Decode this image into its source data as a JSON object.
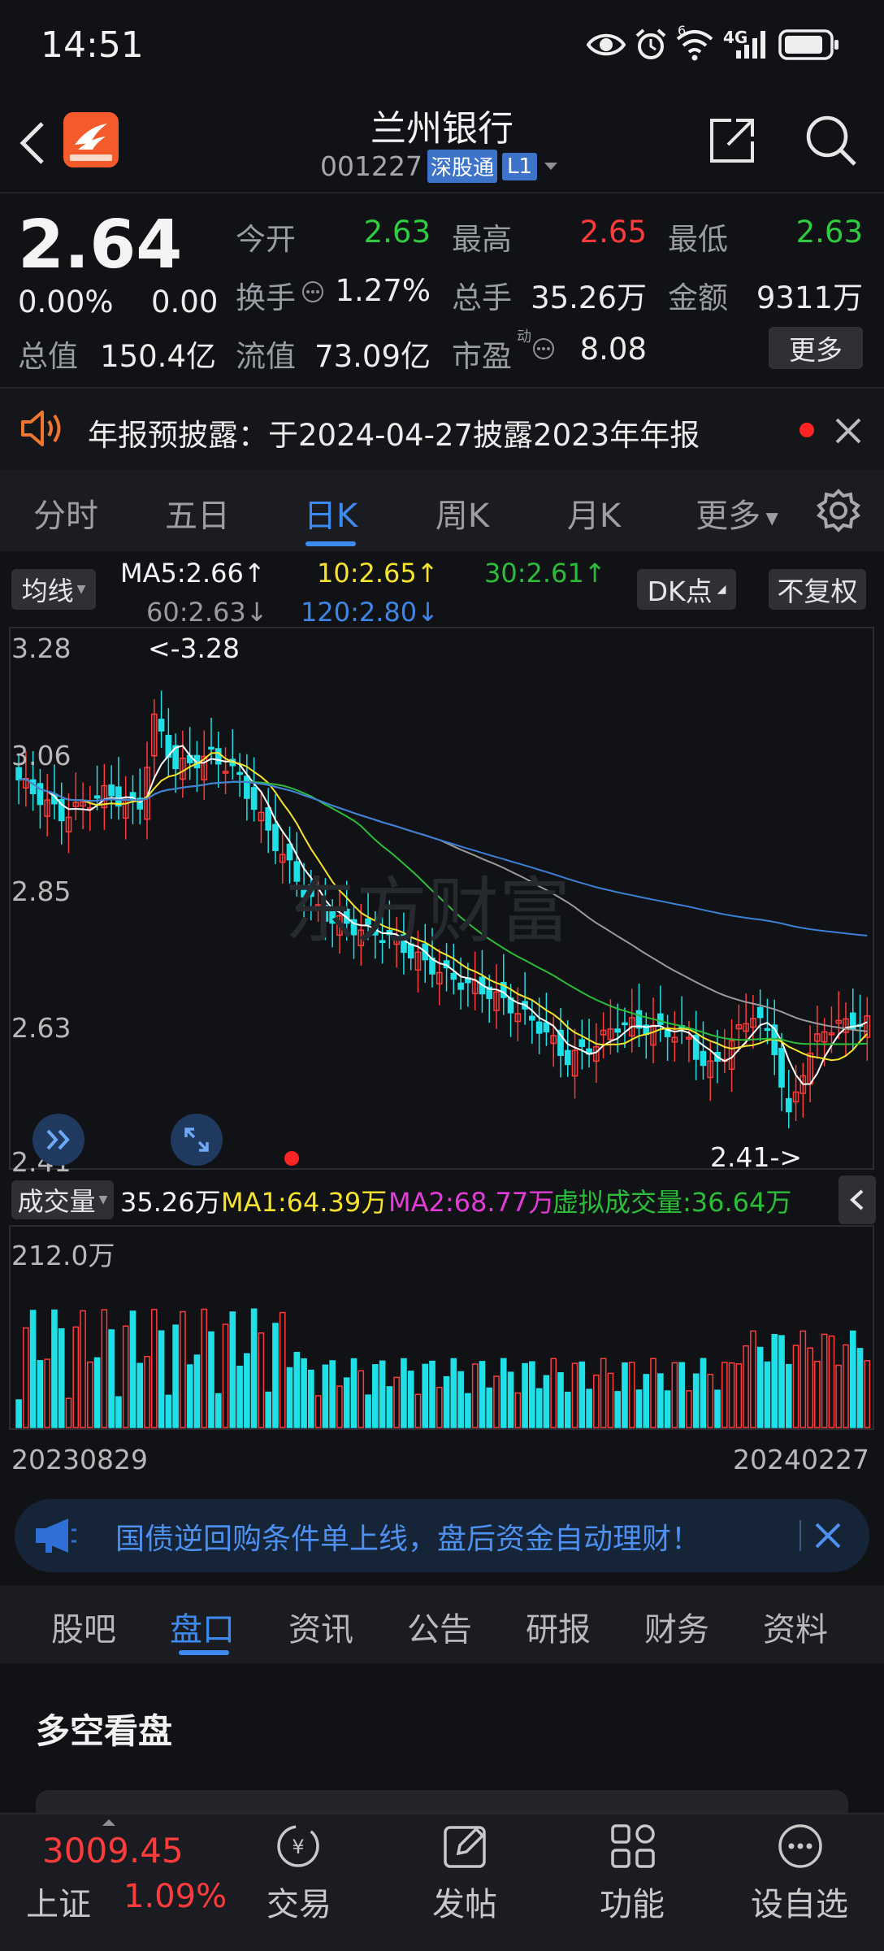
{
  "status_bar": {
    "time": "14:51",
    "signal": "4G",
    "wifi_badge": "6"
  },
  "header": {
    "title": "兰州银行",
    "code": "001227",
    "market_badge": "深股通",
    "level_badge": "L1"
  },
  "quote": {
    "price": "2.64",
    "change_pct": "0.00%",
    "change_amt": "0.00",
    "open_label": "今开",
    "open": "2.63",
    "high_label": "最高",
    "high": "2.65",
    "low_label": "最低",
    "low": "2.63",
    "turnover_label": "换手",
    "turnover": "1.27%",
    "volume_label": "总手",
    "volume": "35.26万",
    "amount_label": "金额",
    "amount": "9311万",
    "mktcap_label": "总值",
    "mktcap": "150.4亿",
    "float_label": "流值",
    "float": "73.09亿",
    "pe_label": "市盈",
    "pe_sup": "动",
    "pe": "8.08",
    "more_label": "更多"
  },
  "notice": {
    "text": "年报预披露：于2024-04-27披露2023年年报"
  },
  "chart_tabs": [
    "分时",
    "五日",
    "日K",
    "周K",
    "月K",
    "更多"
  ],
  "ma": {
    "selector": "均线",
    "ma5": "MA5:2.66↑",
    "ma10": "10:2.65↑",
    "ma30": "30:2.61↑",
    "ma60": "60:2.63↓",
    "ma120": "120:2.80↓",
    "dk": "DK点",
    "fq": "不复权"
  },
  "kline": {
    "ticks": [
      "3.28",
      "3.06",
      "2.85",
      "2.63",
      "2.41"
    ],
    "max_label": "<-3.28",
    "min_label": "2.41->",
    "watermark": "东方财富"
  },
  "volume_panel": {
    "selector": "成交量",
    "current": "35.26万",
    "ma1": "MA1:64.39万",
    "ma2": "MA2:68.77万",
    "virtual": "虚拟成交量:36.64万",
    "max_label": "212.0万",
    "date_start": "20230829",
    "date_end": "20240227"
  },
  "chart_data": {
    "type": "candlestick",
    "x_start": "20230829",
    "x_end": "20240227",
    "ylim": [
      2.41,
      3.28
    ],
    "y_ticks": [
      3.28,
      3.06,
      2.85,
      2.63,
      2.41
    ],
    "ma": {
      "MA5": 2.66,
      "MA10": 2.65,
      "MA30": 2.61,
      "MA60": 2.63,
      "MA120": 2.8
    },
    "max": 3.28,
    "min": 2.41,
    "last_close": 2.64,
    "volume": {
      "max": "212.0万",
      "current": "35.26万",
      "MA1": "64.39万",
      "MA2": "68.77万",
      "virtual": "36.64万"
    }
  },
  "promo": {
    "text": "国债逆回购条件单上线，盘后资金自动理财！"
  },
  "section_tabs": [
    "股吧",
    "盘口",
    "资讯",
    "公告",
    "研报",
    "财务",
    "资料"
  ],
  "section_title": "多空看盘",
  "bottom_nav": {
    "index_value": "3009.45",
    "index_name": "上证",
    "index_change": "1.09%",
    "items": [
      "交易",
      "发帖",
      "功能",
      "设自选"
    ]
  },
  "colors": {
    "up": "#ff3b3b",
    "down": "#1fe0e6",
    "accent": "#3d8bf0",
    "ma5": "#ffffff",
    "ma10": "#f7e32c",
    "ma30": "#2bbd3a",
    "ma60": "#9a9a9a",
    "ma120": "#3b7fd6"
  }
}
